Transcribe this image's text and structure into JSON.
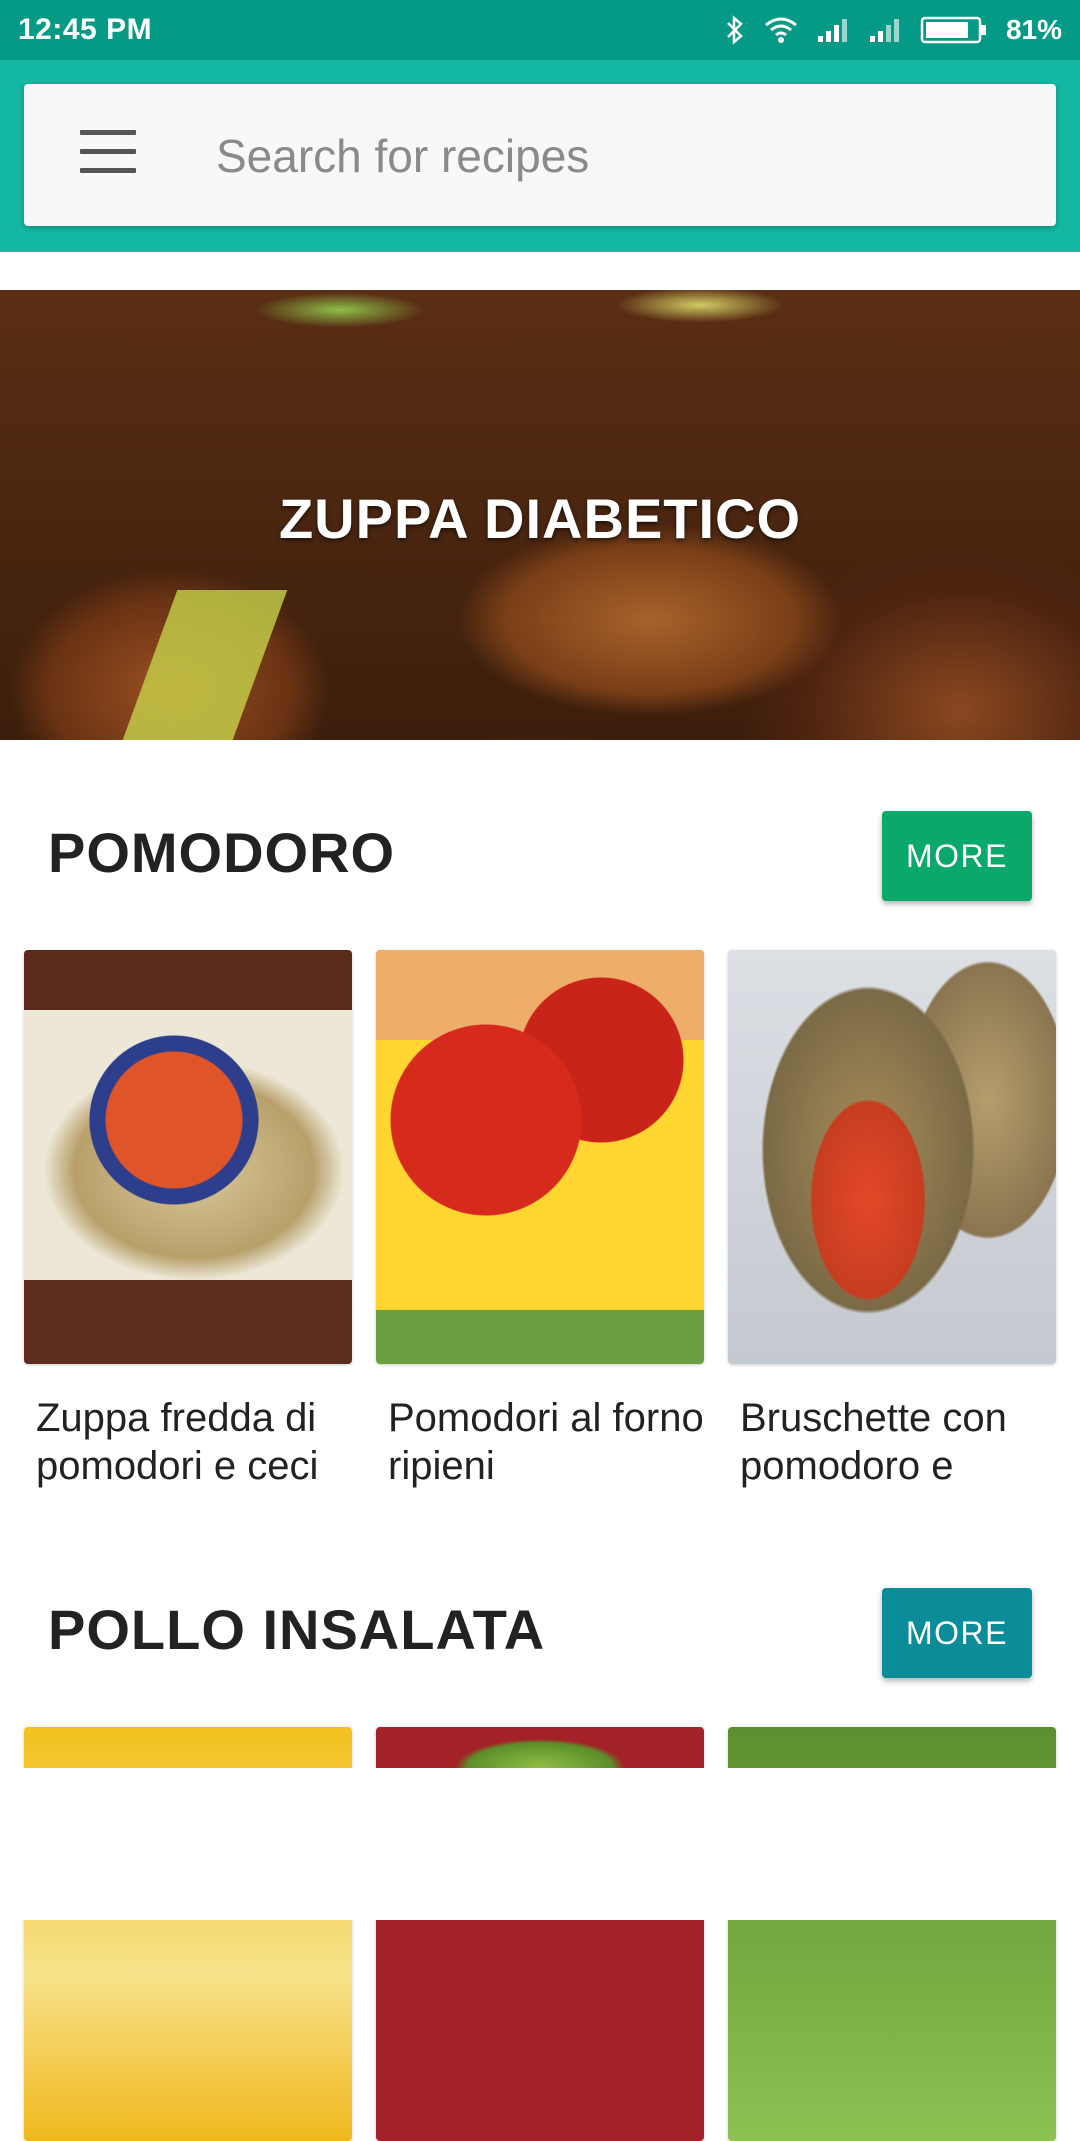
{
  "status_bar": {
    "time": "12:45 PM",
    "battery_percent": "81%"
  },
  "search": {
    "placeholder": "Search for recipes"
  },
  "hero": {
    "title": "ZUPPA DIABETICO"
  },
  "sections": [
    {
      "title": "POMODORO",
      "more_label": "MORE",
      "more_color": "#0aa86a",
      "recipes": [
        {
          "title": "Zuppa fredda di pomodori e ceci"
        },
        {
          "title": "Pomodori al forno ripieni"
        },
        {
          "title": "Bruschette con pomodoro e"
        }
      ]
    },
    {
      "title": "POLLO INSALATA",
      "more_label": "MORE",
      "more_color": "#0b8c99",
      "recipes": []
    }
  ],
  "colors": {
    "status_bar": "#049a86",
    "app_bar": "#14b8a2",
    "search_card": "#f8f8f8"
  }
}
